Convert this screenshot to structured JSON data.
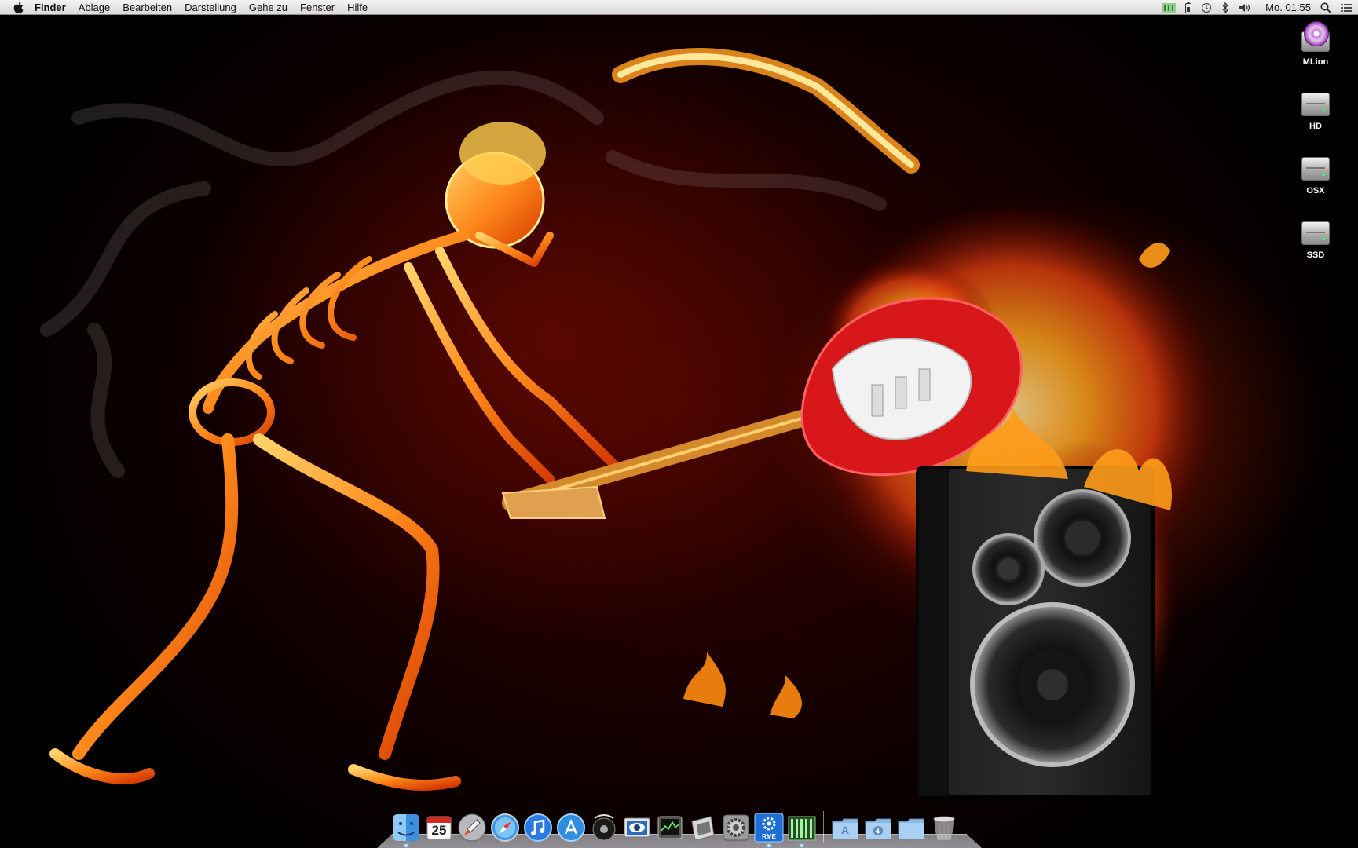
{
  "menubar": {
    "apple_icon": "apple-logo-icon",
    "app_name": "Finder",
    "items": [
      "Ablage",
      "Bearbeiten",
      "Darstellung",
      "Gehe zu",
      "Fenster",
      "Hilfe"
    ],
    "status_icons": [
      "battery-icon",
      "time-machine-icon",
      "bluetooth-icon",
      "volume-icon"
    ],
    "clock": "Mo. 01:55",
    "right_icons": [
      "spotlight-search-icon",
      "notification-list-icon"
    ]
  },
  "desktop": {
    "wallpaper": "flaming-skeleton-guitar-speaker",
    "icons": [
      {
        "label": "MLion",
        "icon": "install-disc-icon"
      },
      {
        "label": "HD",
        "icon": "hard-drive-icon"
      },
      {
        "label": "OSX",
        "icon": "hard-drive-icon"
      },
      {
        "label": "SSD",
        "icon": "hard-drive-icon"
      }
    ]
  },
  "dock": {
    "items": [
      {
        "name": "finder",
        "icon": "finder-icon",
        "running": true
      },
      {
        "name": "calendar",
        "icon": "calendar-icon",
        "calendar_day": "25"
      },
      {
        "name": "launchpad",
        "icon": "rocket-icon"
      },
      {
        "name": "safari",
        "icon": "compass-icon"
      },
      {
        "name": "itunes",
        "icon": "music-note-icon"
      },
      {
        "name": "app-store",
        "icon": "app-store-icon"
      },
      {
        "name": "disk-utility",
        "icon": "stethoscope-disk-icon"
      },
      {
        "name": "preview",
        "icon": "eye-photo-icon"
      },
      {
        "name": "activity-monitor",
        "icon": "graph-monitor-icon"
      },
      {
        "name": "logic",
        "icon": "audio-icon"
      },
      {
        "name": "system-preferences",
        "icon": "gear-icon"
      },
      {
        "name": "rme-totalmix",
        "icon": "rme-gear-icon"
      },
      {
        "name": "mixer",
        "icon": "mixer-faders-icon"
      }
    ],
    "stacks": [
      {
        "name": "applications",
        "icon": "applications-folder-icon"
      },
      {
        "name": "downloads",
        "icon": "downloads-folder-icon"
      },
      {
        "name": "documents",
        "icon": "documents-folder-icon"
      },
      {
        "name": "trash",
        "icon": "trash-icon"
      }
    ],
    "stack_labels": [
      "A"
    ],
    "rme_label": "RME"
  }
}
